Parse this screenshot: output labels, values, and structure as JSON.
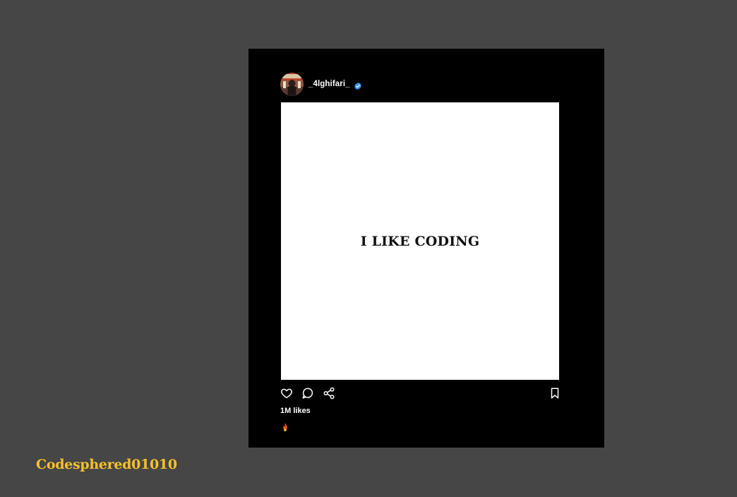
{
  "post": {
    "username": "_4lghifari_",
    "image_text": "I LIKE CODING",
    "likes": "1M likes",
    "caption_emoji": "fire-emoji-icon"
  },
  "icons": {
    "verified": "verified-badge-icon",
    "like": "heart-icon",
    "comment": "comment-icon",
    "share": "share-icon",
    "save": "bookmark-icon"
  },
  "watermark": {
    "text": "Codesphered01010"
  },
  "colors": {
    "page_background": "#464646",
    "card_background": "#000000",
    "image_background": "#ffffff",
    "verified_blue": "#3897f0",
    "watermark_yellow": "#f4c12a",
    "text_white": "#ffffff"
  }
}
